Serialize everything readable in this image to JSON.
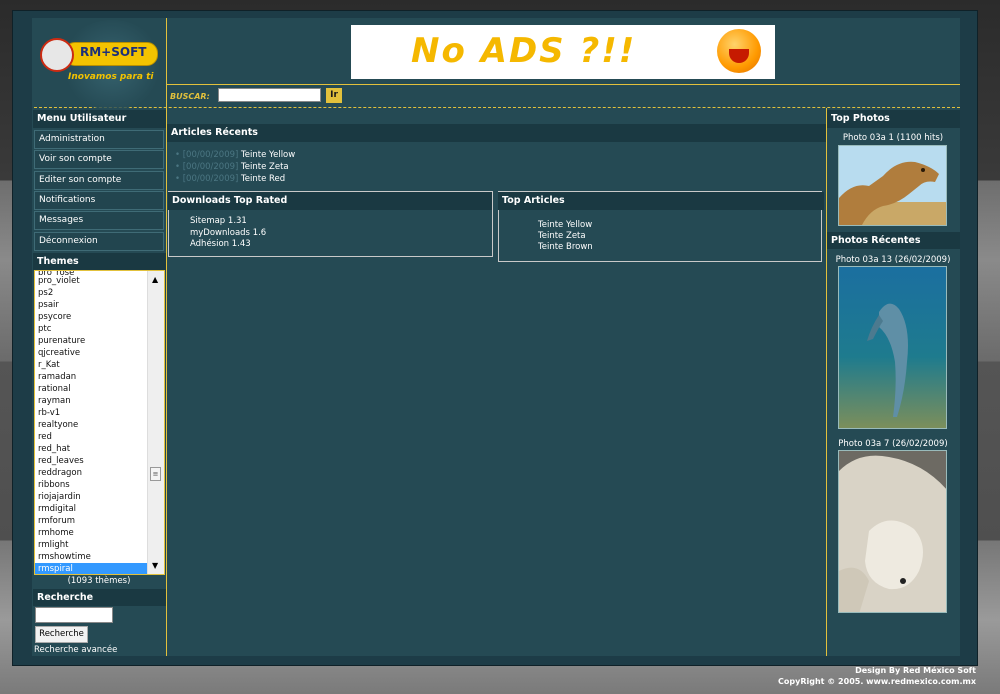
{
  "header": {
    "logo_text": "RM+SOFT",
    "logo_slogan": "Inovamos para ti",
    "banner_text": "No ADS ?!!",
    "search_label": "BUSCAR:",
    "search_value": "",
    "go_label": "Ir"
  },
  "left": {
    "menu_title": "Menu Utilisateur",
    "menu_items": [
      "Administration",
      "Voir son compte",
      "Editer son compte",
      "Notifications",
      "Messages",
      "Déconnexion"
    ],
    "themes_title": "Themes",
    "themes": [
      "pro_violet",
      "ps2",
      "psair",
      "psycore",
      "ptc",
      "purenature",
      "qjcreative",
      "r_Kat",
      "ramadan",
      "rational",
      "rayman",
      "rb-v1",
      "realtyone",
      "red",
      "red_hat",
      "red_leaves",
      "reddragon",
      "ribbons",
      "riojajardin",
      "rmdigital",
      "rmforum",
      "rmhome",
      "rmlight",
      "rmshowtime",
      "rmspiral"
    ],
    "themes_selected": "rmspiral",
    "themes_count": "(1093 thèmes)",
    "search_title": "Recherche",
    "search_button": "Recherche",
    "search_advanced": "Recherche avancée"
  },
  "center": {
    "recent_title": "Articles Récents",
    "recent": [
      "Teinte Yellow",
      "Teinte Zeta",
      "Teinte Red"
    ],
    "downloads_title": "Downloads Top Rated",
    "downloads": [
      "Sitemap 1.31",
      "myDownloads 1.6",
      "Adhésion 1.43"
    ],
    "top_articles_title": "Top Articles",
    "top_articles": [
      "Teinte Yellow",
      "Teinte Zeta",
      "Teinte Brown"
    ]
  },
  "right": {
    "top_photos_title": "Top Photos",
    "top_photo_caption": "Photo 03a 1 (1100 hits)",
    "recent_photos_title": "Photos Récentes",
    "recent_captions": [
      "Photo 03a 13 (26/02/2009)",
      "Photo 03a 7 (26/02/2009)"
    ]
  },
  "footer": {
    "design": "Design By Red México Soft",
    "copyright": "CopyRight © 2005. www.redmexico.com.mx"
  },
  "colors": {
    "accent": "#e2c13c",
    "panel": "#254a54",
    "block_title": "#1a3942",
    "selection": "#3399ff"
  }
}
